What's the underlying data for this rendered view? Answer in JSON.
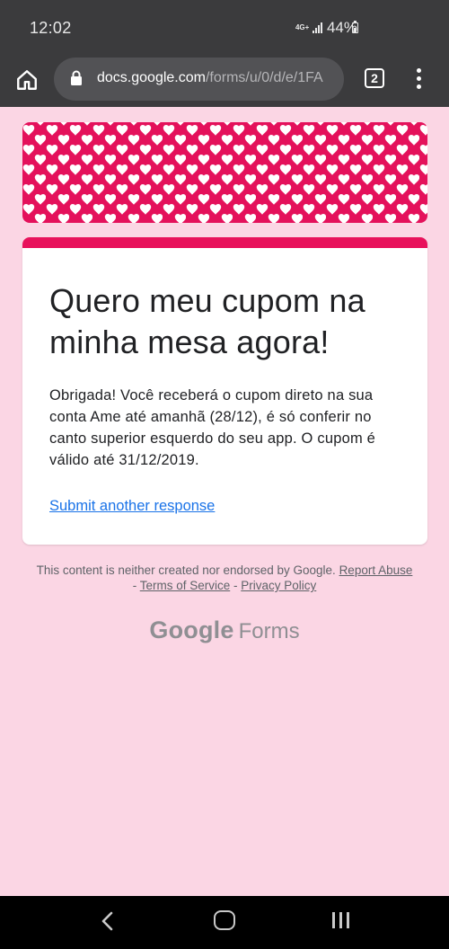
{
  "status_bar": {
    "time": "12:02",
    "network": "4G+",
    "battery": "44%",
    "battery_level": 0.44
  },
  "browser": {
    "url_host": "docs.google.com",
    "url_path": "/forms/u/0/d/e/1FA",
    "tab_count": "2",
    "home_icon": "home-icon",
    "lock_icon": "lock-icon",
    "menu_icon": "more-vert-icon"
  },
  "form": {
    "accent_color": "#e8115b",
    "background_color": "#fbd6e4",
    "title": "Quero meu cupom na minha mesa agora!",
    "confirmation_message": "Obrigada! Você receberá o cupom direto na sua conta Ame até amanhã (28/12), é só conferir no canto superior esquerdo do seu app. O cupom é válido até 31/12/2019.",
    "submit_another_link": "Submit another response"
  },
  "footer": {
    "disclaimer_text": "This content is neither created nor endorsed by Google. ",
    "report_abuse": "Report Abuse",
    "separator": " - ",
    "terms": "Terms of Service",
    "privacy": "Privacy Policy",
    "logo_google": "Google",
    "logo_forms": "Forms"
  },
  "nav_bar": {
    "back_icon": "back-icon",
    "home_icon": "home-circle-icon",
    "recents_icon": "recents-icon"
  }
}
